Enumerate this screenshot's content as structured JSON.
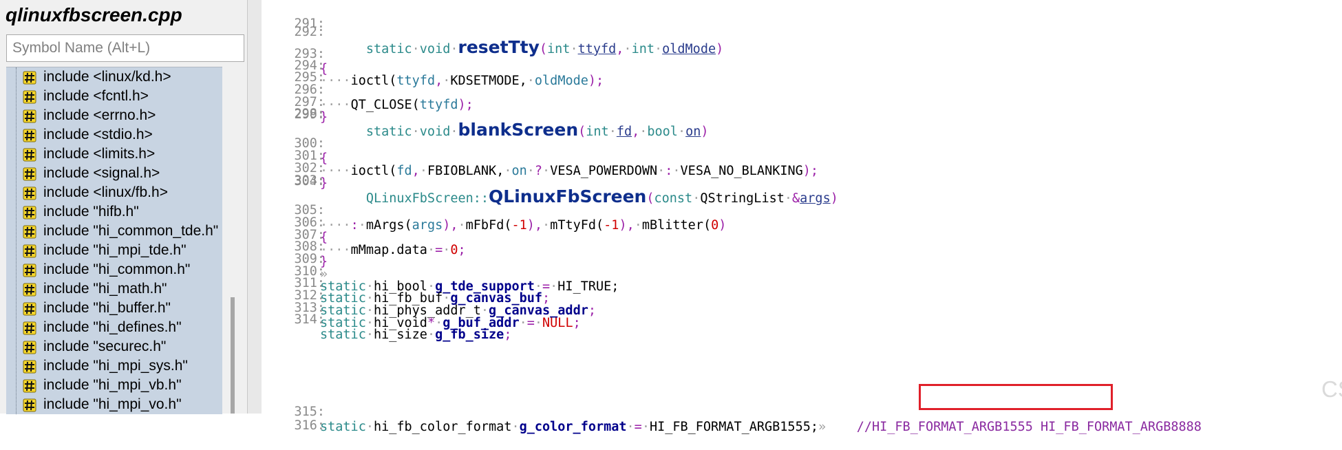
{
  "symbol_panel": {
    "file_title": "qlinuxfbscreen.cpp",
    "search_placeholder": "Symbol Name (Alt+L)",
    "items": [
      "include <linux/kd.h>",
      "include <fcntl.h>",
      "include <errno.h>",
      "include <stdio.h>",
      "include <limits.h>",
      "include <signal.h>",
      "include <linux/fb.h>",
      "include \"hifb.h\"",
      "include \"hi_common_tde.h\"",
      "include \"hi_mpi_tde.h\"",
      "include \"hi_common.h\"",
      "include \"hi_math.h\"",
      "include \"hi_buffer.h\"",
      "include \"hi_defines.h\"",
      "include \"securec.h\"",
      "include \"hi_mpi_sys.h\"",
      "include \"hi_mpi_vb.h\"",
      "include \"hi_mpi_vo.h\""
    ]
  },
  "editor": {
    "line_numbers": [
      "291:",
      "292:",
      "293:",
      "294:",
      "295:",
      "296:",
      "297:",
      "298:",
      "299:",
      "300:",
      "301:",
      "302:",
      "303:",
      "304:",
      "305:",
      "306:",
      "307:",
      "308:",
      "309:",
      "310:",
      "311:",
      "312:",
      "313:",
      "314:",
      "315:",
      "316:"
    ],
    "code": {
      "l292": {
        "kw1": "static",
        "kw2": "void",
        "fn": "resetTty",
        "open": "(",
        "kw3": "int",
        "p1": "ttyfd",
        "comma": ",",
        "kw4": "int",
        "p2": "oldMode",
        "close": ")"
      },
      "l293": {
        "brace": "{"
      },
      "l294": {
        "call": "ioctl(",
        "a1": "ttyfd",
        "sep1": ",",
        "a2": "KDSETMODE,",
        "a3": "oldMode",
        "end": ");"
      },
      "l296": {
        "call": "QT_CLOSE(",
        "a1": "ttyfd",
        "end": ");"
      },
      "l297": {
        "brace": "}"
      },
      "l299": {
        "kw1": "static",
        "kw2": "void",
        "fn": "blankScreen",
        "open": "(",
        "kw3": "int",
        "p1": "fd",
        "comma": ",",
        "kw4": "bool",
        "p2": "on",
        "close": ")"
      },
      "l300": {
        "brace": "{"
      },
      "l301": {
        "call": "ioctl(",
        "a1": "fd",
        "sep1": ",",
        "a2": "FBIOBLANK,",
        "a3": "on",
        "q": "?",
        "a4": "VESA_POWERDOWN",
        "c": ":",
        "a5": "VESA_NO_BLANKING",
        "end": ");"
      },
      "l302": {
        "brace": "}"
      },
      "l304": {
        "cls": "QLinuxFbScreen::",
        "fn": "QLinuxFbScreen",
        "open": "(",
        "kw1": "const",
        "type": "QStringList",
        "amp": "&",
        "p1": "args",
        "close": ")"
      },
      "l305": {
        "colon": ":",
        "m1": "mArgs(",
        "a1": "args",
        "m1e": "),",
        "m2": "mFbFd(",
        "n1": "-1",
        "m2e": "),",
        "m3": "mTtyFd(",
        "n2": "-1",
        "m3e": "),",
        "m4": "mBlitter(",
        "n3": "0",
        "m4e": ")"
      },
      "l306": {
        "brace": "{"
      },
      "l307": {
        "stmt": "mMmap.data",
        "eq": "=",
        "n": "0",
        "end": ";"
      },
      "l308": {
        "brace": "}"
      },
      "l309": {
        "tab": "»"
      },
      "l310": {
        "kw": "static",
        "type": "hi_bool",
        "var": "g_tde_support",
        "eq": "=",
        "val": "HI_TRUE;"
      },
      "l311": {
        "kw": "static",
        "type": "hi_fb_buf",
        "var": "g_canvas_buf",
        "end": ";"
      },
      "l312": {
        "kw": "static",
        "type": "hi_phys_addr_t",
        "var": "g_canvas_addr",
        "end": ";"
      },
      "l313": {
        "kw": "static",
        "type": "hi_void",
        "star": "*",
        "var": "g_buf_addr",
        "eq": "=",
        "val": "NULL",
        "end": ";"
      },
      "l314": {
        "kw": "static",
        "type": "hi_size",
        "var": "g_fb_size",
        "end": ";"
      },
      "l315": {
        "kw": "static",
        "type": "hi_fb_color_format",
        "var": "g_color_format",
        "eq": "=",
        "val": "HI_FB_FORMAT_ARGB1555;",
        "tab": "»",
        "comment": "//HI_FB_FORMAT_ARGB1555 HI_FB_FORMAT_ARGB8888"
      }
    },
    "watermark": "CSDN @UncleRoderick"
  },
  "colors": {
    "highlight_box": "#e0202a",
    "symbol_list_bg": "#c8d4e2",
    "keyword": "#2b8a8a",
    "function": "#0e2e8c",
    "number": "#d00000"
  }
}
